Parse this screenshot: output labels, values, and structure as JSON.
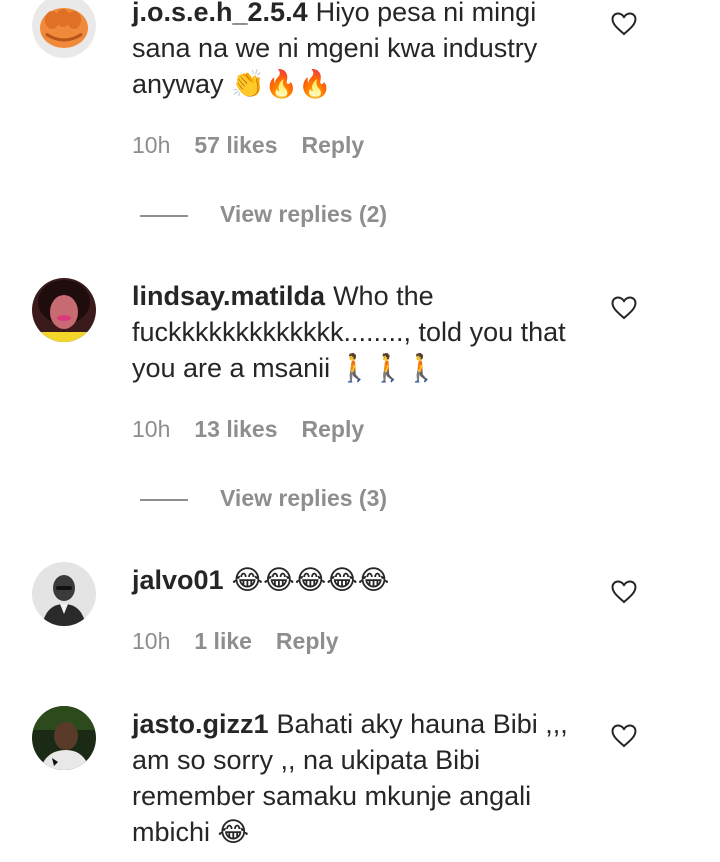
{
  "comments": [
    {
      "username": "j.o.s.e.h_2.5.4",
      "text": "Hiyo pesa ni mingi sana na we ni mgeni kwa industry anyway 👏🔥🔥",
      "time": "10h",
      "likes": "57 likes",
      "reply": "Reply",
      "view_replies": "View replies (2)",
      "avatar_icon": "fist-avatar"
    },
    {
      "username": "lindsay.matilda",
      "text": "Who the fuckkkkkkkkkkkkk........, told you that you are a msanii 🚶🚶🚶",
      "time": "10h",
      "likes": "13 likes",
      "reply": "Reply",
      "view_replies": "View replies (3)",
      "avatar_icon": "profile-photo-avatar"
    },
    {
      "username": "jalvo01",
      "text": "😂😂😂😂😂",
      "time": "10h",
      "likes": "1 like",
      "reply": "Reply",
      "avatar_icon": "bw-portrait-avatar"
    },
    {
      "username": "jasto.gizz1",
      "text": "Bahati aky hauna Bibi ,,, am so sorry ,, na ukipata Bibi remember samaku mkunje angali mbichi 😂",
      "avatar_icon": "tiktok-portrait-avatar"
    }
  ],
  "icons": {
    "like": "heart-outline-icon"
  },
  "colors": {
    "text": "#262626",
    "secondary": "#8e8e8e",
    "background": "#ffffff"
  }
}
